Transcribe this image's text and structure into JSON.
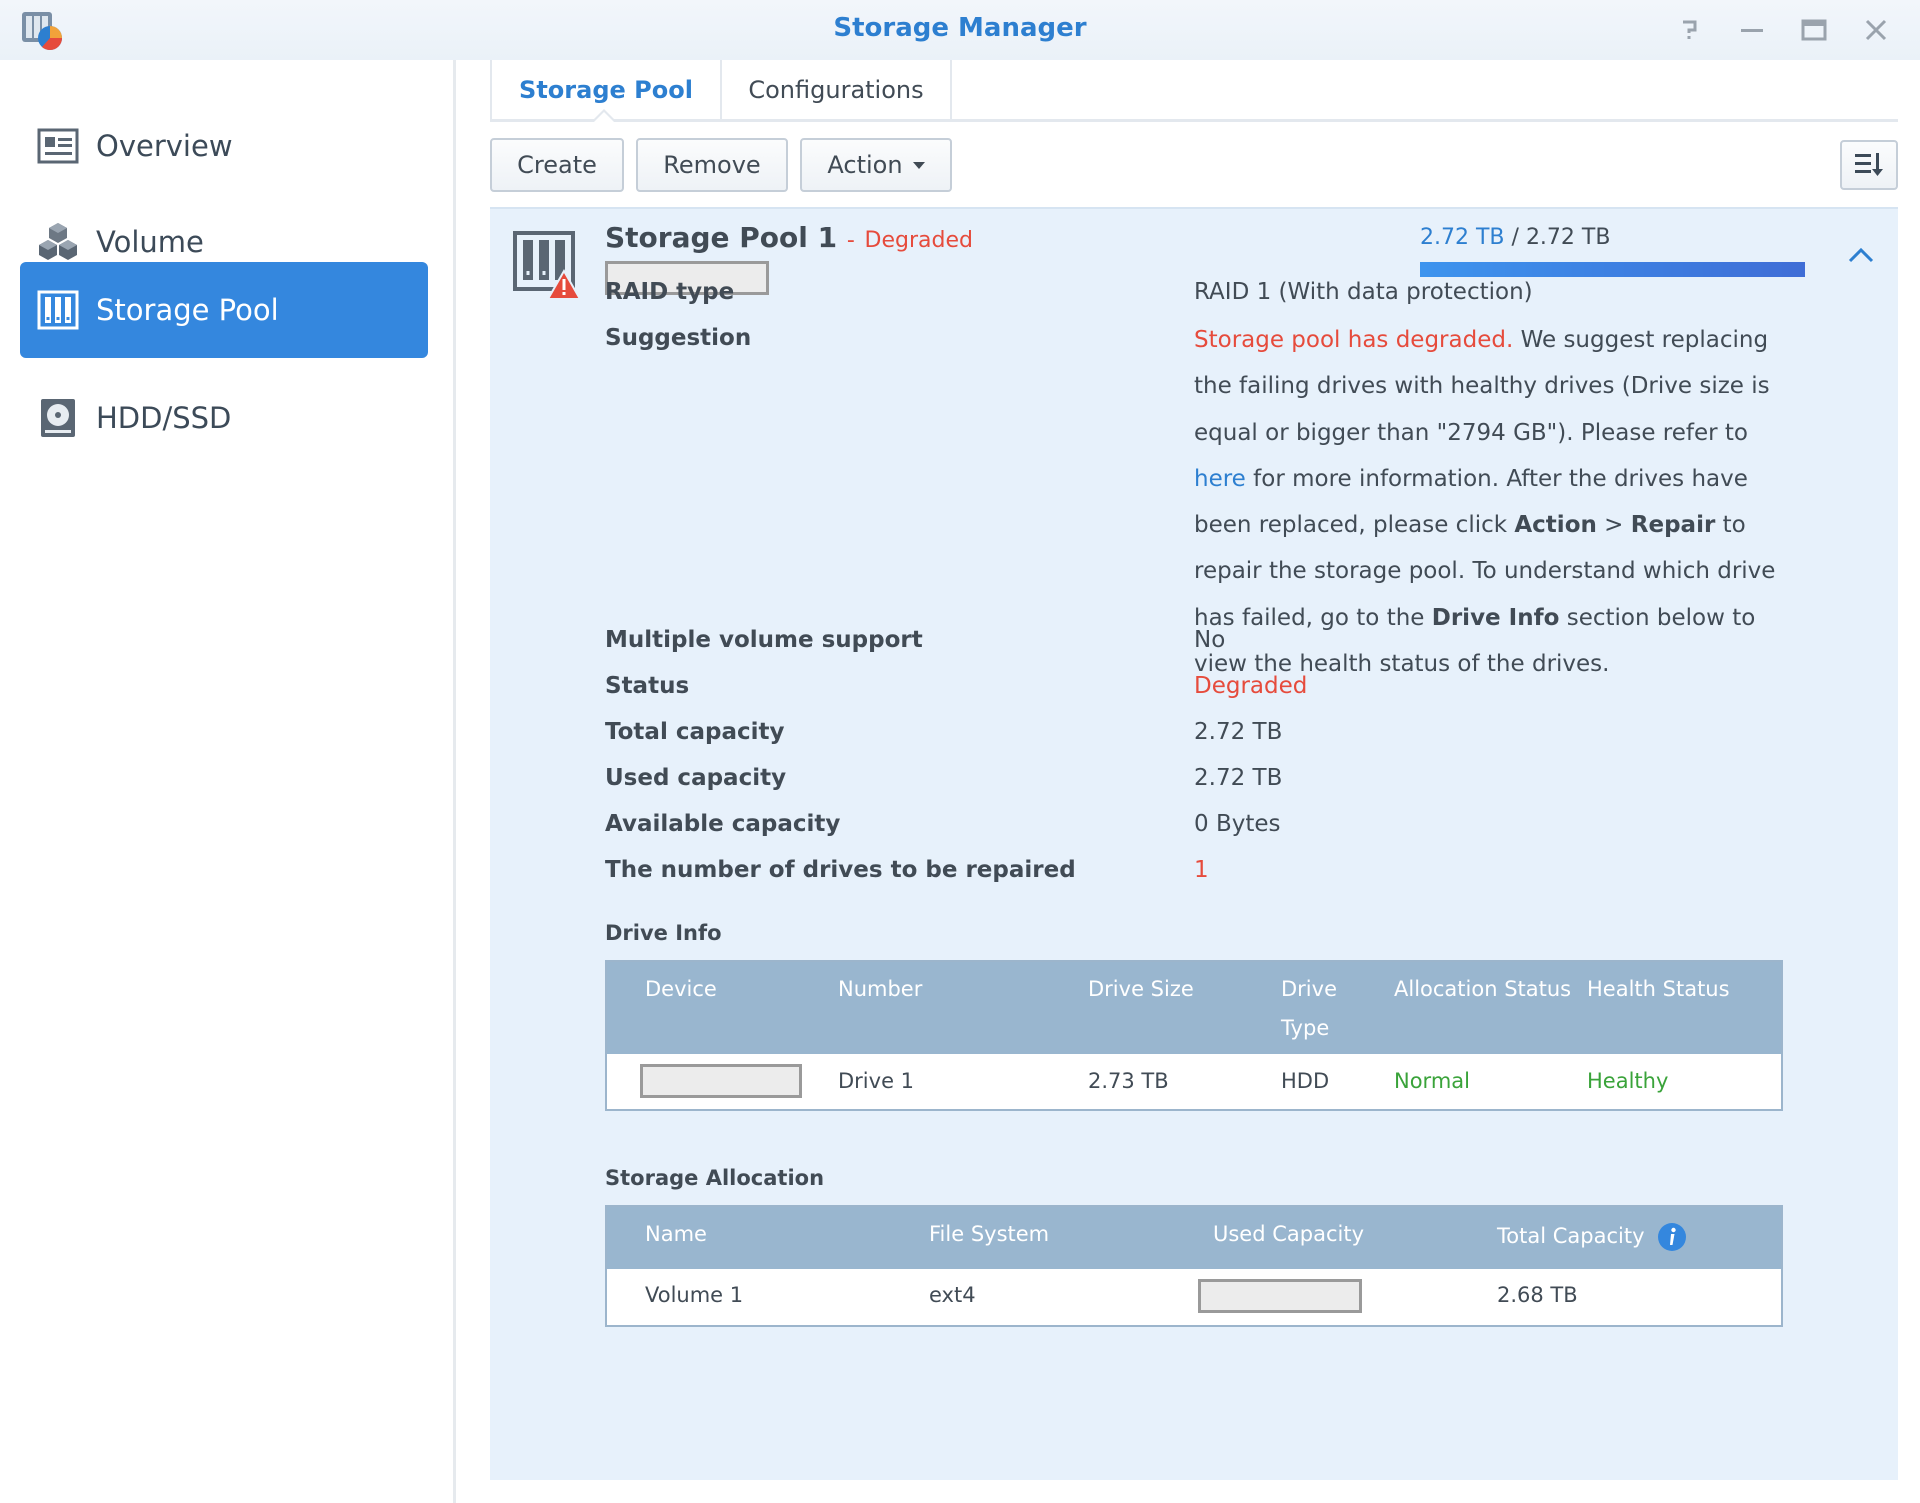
{
  "window": {
    "title": "Storage Manager",
    "help_icon": "help-icon",
    "minimize_icon": "minimize-icon",
    "maximize_icon": "maximize-icon",
    "close_icon": "close-icon"
  },
  "sidebar": {
    "items": [
      {
        "label": "Overview",
        "icon": "overview-icon"
      },
      {
        "label": "Volume",
        "icon": "volume-cubes-icon"
      },
      {
        "label": "Storage Pool",
        "icon": "storage-pool-icon",
        "active": true
      },
      {
        "label": "HDD/SSD",
        "icon": "hdd-icon"
      }
    ]
  },
  "tabs": [
    {
      "label": "Storage Pool",
      "active": true
    },
    {
      "label": "Configurations",
      "active": false
    }
  ],
  "toolbar": {
    "create_label": "Create",
    "remove_label": "Remove",
    "action_label": "Action",
    "sort_icon": "sort-icon"
  },
  "pool": {
    "name": "Storage Pool 1",
    "separator": "-",
    "status_label": "Degraded",
    "usage_used": "2.72 TB",
    "usage_separator": "/",
    "usage_total": "2.72 TB",
    "usage_fraction": 1.0,
    "properties": {
      "raid_type": {
        "label": "RAID type",
        "value": "RAID 1 (With data protection)"
      },
      "suggestion": {
        "label": "Suggestion",
        "warning": "Storage pool has degraded.",
        "text_1": " We suggest replacing the failing drives with healthy drives (Drive size is equal or bigger than \"2794 GB\"). Please refer to ",
        "link": "here",
        "text_2": " for more information. After the drives have been replaced, please click ",
        "bold_action": "Action",
        "arrow": " > ",
        "bold_repair": "Repair",
        "text_3": " to repair the storage pool. To understand which drive has failed, go to the ",
        "bold_drive_info": "Drive Info",
        "text_4": " section below to view the health status of the drives."
      },
      "multiple_volume": {
        "label": "Multiple volume support",
        "value": "No"
      },
      "status": {
        "label": "Status",
        "value": "Degraded"
      },
      "total_capacity": {
        "label": "Total capacity",
        "value": "2.72 TB"
      },
      "used_capacity": {
        "label": "Used capacity",
        "value": "2.72 TB"
      },
      "available_capacity": {
        "label": "Available capacity",
        "value": "0 Bytes"
      },
      "drives_to_repair": {
        "label": "The number of drives to be repaired",
        "value": "1"
      }
    }
  },
  "drive_info": {
    "title": "Drive Info",
    "columns": [
      "Device",
      "Number",
      "Drive Size",
      "Drive",
      "Type",
      "Allocation Status",
      "Health Status"
    ],
    "rows": [
      {
        "device": "",
        "number": "Drive 1",
        "size": "2.73 TB",
        "type": "HDD",
        "allocation": "Normal",
        "health": "Healthy"
      }
    ]
  },
  "storage_allocation": {
    "title": "Storage Allocation",
    "columns": [
      "Name",
      "File System",
      "Used Capacity",
      "Total Capacity"
    ],
    "info_icon": "info-icon",
    "rows": [
      {
        "name": "Volume 1",
        "file_system": "ext4",
        "used": "",
        "total": "2.68 TB"
      }
    ]
  },
  "colors": {
    "accent": "#3487de",
    "title_blue": "#2d7fd0",
    "danger": "#e64b3c",
    "success": "#3aa33a",
    "panel_bg": "#e7f1fb",
    "table_header": "#99b6cf"
  }
}
